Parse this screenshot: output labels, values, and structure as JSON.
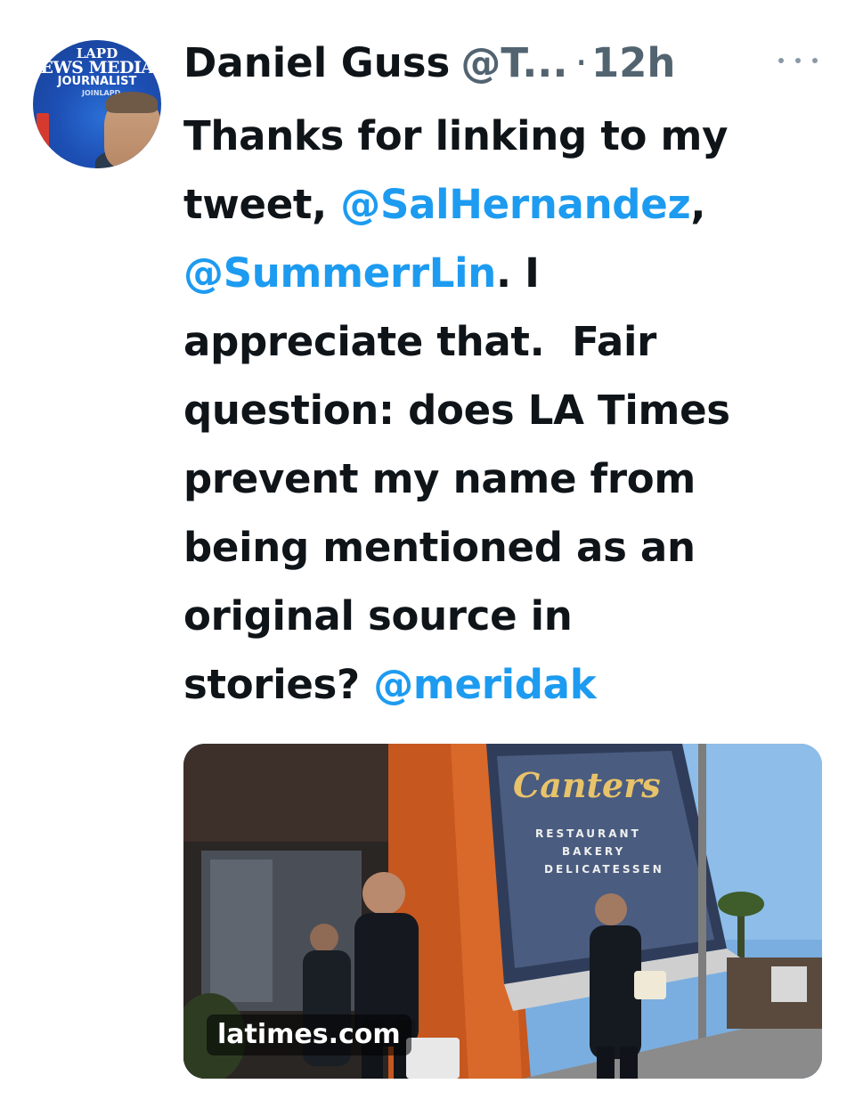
{
  "tweet": {
    "author_name": "Daniel Guss",
    "author_handle": "@T...",
    "separator": "·",
    "time": "12h",
    "avatar_badge": [
      "LAPD",
      "EWS MEDIA",
      "JOURNALIST",
      "JOINLAPD"
    ],
    "text_lines": [
      [
        {
          "t": "Thanks for linking to my"
        }
      ],
      [
        {
          "t": "tweet, "
        },
        {
          "t": "@SalHernandez",
          "mention": true
        },
        {
          "t": ","
        }
      ],
      [
        {
          "t": "@SummerrLin",
          "mention": true
        },
        {
          "t": ". I"
        }
      ],
      [
        {
          "t": "appreciate that.  Fair"
        }
      ],
      [
        {
          "t": "question: does LA Times"
        }
      ],
      [
        {
          "t": "prevent my name from"
        }
      ],
      [
        {
          "t": "being mentioned as an"
        }
      ],
      [
        {
          "t": "original source in"
        }
      ],
      [
        {
          "t": "stories? "
        },
        {
          "t": "@meridak",
          "mention": true
        }
      ]
    ],
    "link_card": {
      "domain": "latimes.com",
      "image_description_icon": "photo-thumbnail"
    }
  },
  "colors": {
    "text": "#0f1419",
    "secondary": "#536471",
    "mention": "#1d9bf0",
    "background": "#ffffff"
  }
}
